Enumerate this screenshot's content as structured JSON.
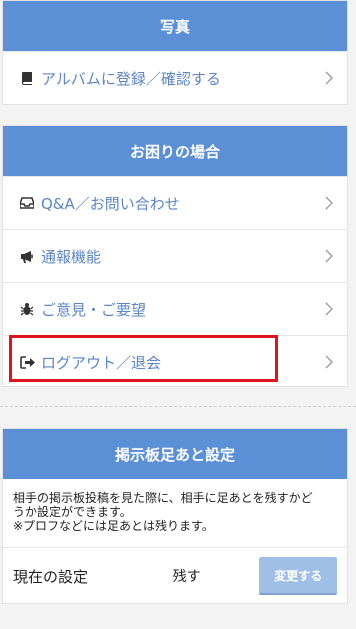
{
  "photo_section": {
    "header": "写真",
    "items": [
      {
        "label": "アルバムに登録／確認する",
        "icon": "book-icon"
      }
    ]
  },
  "help_section": {
    "header": "お困りの場合",
    "items": [
      {
        "label": "Q&A／お問い合わせ",
        "icon": "inbox-icon"
      },
      {
        "label": "通報機能",
        "icon": "megaphone-icon"
      },
      {
        "label": "ご意見・ご要望",
        "icon": "bug-icon"
      },
      {
        "label": "ログアウト／退会",
        "icon": "sign-out-icon"
      }
    ]
  },
  "footprint_section": {
    "header": "掲示板足あと設定",
    "description_line1": "相手の掲示板投稿を見た際に、相手に足あとを残すかど",
    "description_line2": "うか設定ができます。",
    "description_line3": "※プロフなどには足あとは残ります。",
    "current_label": "現在の設定",
    "current_value": "残す",
    "change_button": "変更する"
  },
  "colors": {
    "header_bg": "#5b8fd6",
    "link_text": "#5b86c4",
    "highlight": "#e0141e",
    "button_bg": "#9fbfe6"
  }
}
